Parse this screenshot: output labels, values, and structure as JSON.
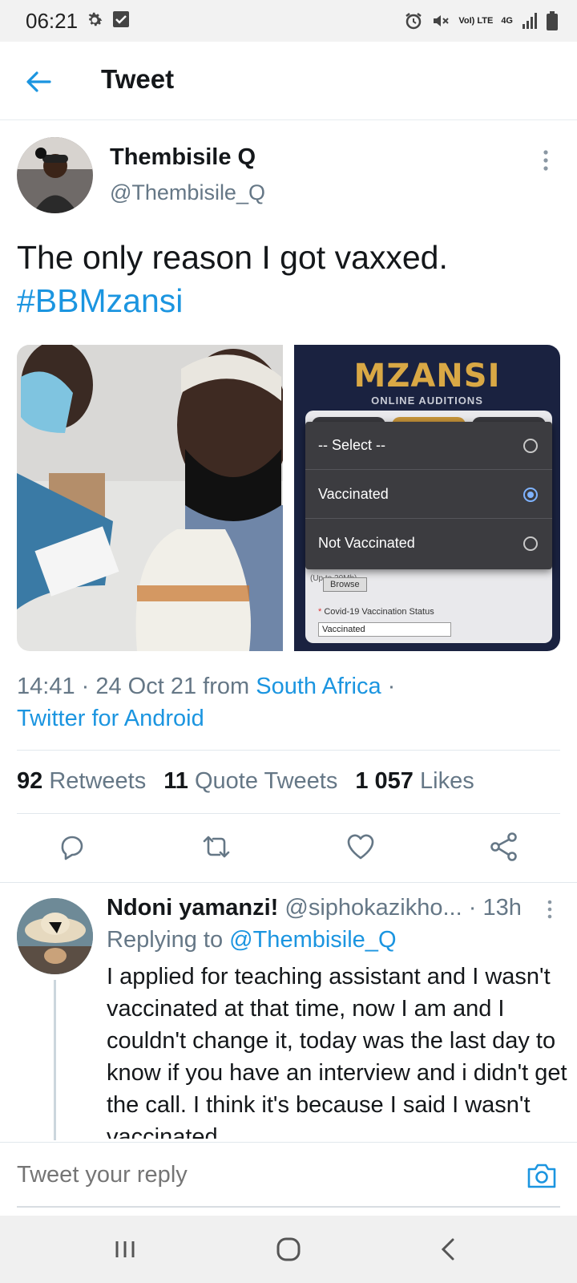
{
  "status_bar": {
    "time": "06:21",
    "network": "4G",
    "volte": "VoI) LTE"
  },
  "header": {
    "title": "Tweet"
  },
  "tweet": {
    "author_name": "Thembisile Q",
    "author_handle": "@Thembisile_Q",
    "text": "The only reason I got vaxxed.",
    "hashtag": "#BBMzansi",
    "media_right": {
      "title": "MZANSI",
      "subtitle": "ONLINE AUDITIONS",
      "options": [
        "-- Select --",
        "Vaccinated",
        "Not Vaccinated"
      ],
      "selected_option": "Vaccinated",
      "upload_hint": "(Up to 20Mb)",
      "browse_label": "Browse",
      "status_label": "Covid-19 Vaccination Status",
      "status_value": "Vaccinated"
    },
    "time": "14:41",
    "date": "24 Oct 21",
    "from_label": "from",
    "location": "South Africa",
    "source": "Twitter for Android"
  },
  "stats": {
    "retweets_count": "92",
    "retweets_label": "Retweets",
    "quotes_count": "11",
    "quotes_label": "Quote Tweets",
    "likes_count": "1 057",
    "likes_label": "Likes"
  },
  "reply": {
    "author_name": "Ndoni yamanzi!",
    "author_handle": "@siphokazikho...",
    "age": "13h",
    "replying_label": "Replying to",
    "replying_handle": "@Thembisile_Q",
    "text": "I applied for teaching assistant and I wasn't vaccinated at that time, now I am and I couldn't change it, today was the last day to know if you have an interview and i didn't get the call. I think it's because I said I wasn't vaccinated"
  },
  "compose": {
    "placeholder": "Tweet your reply"
  },
  "colors": {
    "accent": "#1b95e0",
    "secondary_text": "#657786",
    "divider": "#e1e8ed"
  }
}
